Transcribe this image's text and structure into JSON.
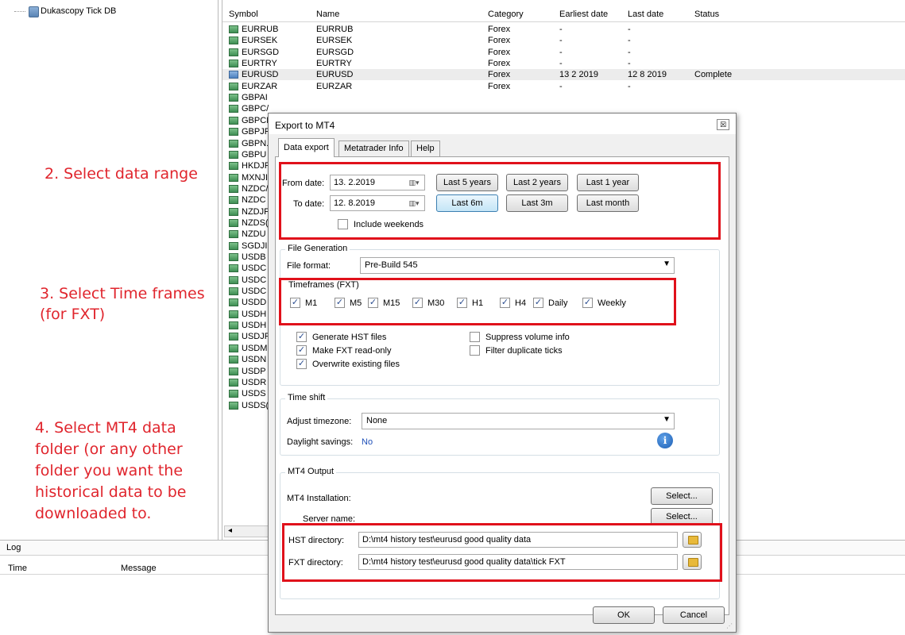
{
  "tree": {
    "root_label": "Dukascopy Tick DB"
  },
  "table": {
    "columns": [
      "Symbol",
      "Name",
      "Category",
      "Earliest date",
      "Last date",
      "Status"
    ],
    "rows": [
      {
        "symbol": "EURRUB",
        "name": "EURRUB",
        "category": "Forex",
        "earliest": "-",
        "last": "-",
        "status": ""
      },
      {
        "symbol": "EURSEK",
        "name": "EURSEK",
        "category": "Forex",
        "earliest": "-",
        "last": "-",
        "status": ""
      },
      {
        "symbol": "EURSGD",
        "name": "EURSGD",
        "category": "Forex",
        "earliest": "-",
        "last": "-",
        "status": ""
      },
      {
        "symbol": "EURTRY",
        "name": "EURTRY",
        "category": "Forex",
        "earliest": "-",
        "last": "-",
        "status": ""
      },
      {
        "symbol": "EURUSD",
        "name": "EURUSD",
        "category": "Forex",
        "earliest": "13 2 2019",
        "last": "12 8 2019",
        "status": "Complete"
      },
      {
        "symbol": "EURZAR",
        "name": "EURZAR",
        "category": "Forex",
        "earliest": "-",
        "last": "-",
        "status": ""
      },
      {
        "symbol": "GBPAI",
        "name": "",
        "category": "",
        "earliest": "",
        "last": "",
        "status": ""
      },
      {
        "symbol": "GBPC/",
        "name": "",
        "category": "",
        "earliest": "",
        "last": "",
        "status": ""
      },
      {
        "symbol": "GBPCI",
        "name": "",
        "category": "",
        "earliest": "",
        "last": "",
        "status": ""
      },
      {
        "symbol": "GBPJF",
        "name": "",
        "category": "",
        "earliest": "",
        "last": "",
        "status": ""
      },
      {
        "symbol": "GBPN.",
        "name": "",
        "category": "",
        "earliest": "",
        "last": "",
        "status": ""
      },
      {
        "symbol": "GBPU",
        "name": "",
        "category": "",
        "earliest": "",
        "last": "",
        "status": ""
      },
      {
        "symbol": "HKDJF",
        "name": "",
        "category": "",
        "earliest": "",
        "last": "",
        "status": ""
      },
      {
        "symbol": "MXNJI",
        "name": "",
        "category": "",
        "earliest": "",
        "last": "",
        "status": ""
      },
      {
        "symbol": "NZDC/",
        "name": "",
        "category": "",
        "earliest": "",
        "last": "",
        "status": ""
      },
      {
        "symbol": "NZDC",
        "name": "",
        "category": "",
        "earliest": "",
        "last": "",
        "status": ""
      },
      {
        "symbol": "NZDJF",
        "name": "",
        "category": "",
        "earliest": "",
        "last": "",
        "status": ""
      },
      {
        "symbol": "NZDS(",
        "name": "",
        "category": "",
        "earliest": "",
        "last": "",
        "status": ""
      },
      {
        "symbol": "NZDU",
        "name": "",
        "category": "",
        "earliest": "",
        "last": "",
        "status": ""
      },
      {
        "symbol": "SGDJI",
        "name": "",
        "category": "",
        "earliest": "",
        "last": "",
        "status": ""
      },
      {
        "symbol": "USDB",
        "name": "",
        "category": "",
        "earliest": "",
        "last": "",
        "status": ""
      },
      {
        "symbol": "USDC",
        "name": "",
        "category": "",
        "earliest": "",
        "last": "",
        "status": ""
      },
      {
        "symbol": "USDC",
        "name": "",
        "category": "",
        "earliest": "",
        "last": "",
        "status": ""
      },
      {
        "symbol": "USDC",
        "name": "",
        "category": "",
        "earliest": "",
        "last": "",
        "status": ""
      },
      {
        "symbol": "USDD",
        "name": "",
        "category": "",
        "earliest": "",
        "last": "",
        "status": ""
      },
      {
        "symbol": "USDH",
        "name": "",
        "category": "",
        "earliest": "",
        "last": "",
        "status": ""
      },
      {
        "symbol": "USDH",
        "name": "",
        "category": "",
        "earliest": "",
        "last": "",
        "status": ""
      },
      {
        "symbol": "USDJF",
        "name": "",
        "category": "",
        "earliest": "",
        "last": "",
        "status": ""
      },
      {
        "symbol": "USDM",
        "name": "",
        "category": "",
        "earliest": "",
        "last": "",
        "status": ""
      },
      {
        "symbol": "USDN",
        "name": "",
        "category": "",
        "earliest": "",
        "last": "",
        "status": ""
      },
      {
        "symbol": "USDP",
        "name": "",
        "category": "",
        "earliest": "",
        "last": "",
        "status": ""
      },
      {
        "symbol": "USDR",
        "name": "",
        "category": "",
        "earliest": "",
        "last": "",
        "status": ""
      },
      {
        "symbol": "USDS",
        "name": "",
        "category": "",
        "earliest": "",
        "last": "",
        "status": ""
      },
      {
        "symbol": "USDS(",
        "name": "",
        "category": "",
        "earliest": "",
        "last": "",
        "status": ""
      }
    ],
    "selected_index": 4,
    "scroll_left_glyph": "◂"
  },
  "log": {
    "title": "Log",
    "columns": [
      "Time",
      "Message"
    ]
  },
  "annotations": {
    "step2": "2. Select data range",
    "step3_line1": "3. Select Time frames",
    "step3_line2": "(for FXT)",
    "step4_line1": "4. Select MT4 data",
    "step4_line2": "folder (or any other",
    "step4_line3": "folder you want the",
    "step4_line4": "historical data to be",
    "step4_line5": "downloaded to."
  },
  "dialog": {
    "title": "Export to MT4",
    "close_glyph": "☒",
    "tabs": [
      "Data export",
      "Metatrader Info",
      "Help"
    ],
    "active_tab": 0,
    "from_label": "From date:",
    "from_value": "13. 2.2019",
    "to_label": "To date:",
    "to_value": "12. 8.2019",
    "cal_glyph": "▥▾",
    "range_buttons_row1": [
      "Last 5 years",
      "Last 2 years",
      "Last 1 year"
    ],
    "range_buttons_row2": [
      "Last 6m",
      "Last 3m",
      "Last month"
    ],
    "include_weekends_label": "Include weekends",
    "include_weekends": false,
    "file_generation": {
      "title": "File Generation",
      "format_label": "File format:",
      "format_value": "Pre-Build 545",
      "timeframes_title": "Timeframes (FXT)",
      "timeframes": [
        {
          "label": "M1",
          "checked": true
        },
        {
          "label": "M5",
          "checked": true
        },
        {
          "label": "M15",
          "checked": true
        },
        {
          "label": "M30",
          "checked": true
        },
        {
          "label": "H1",
          "checked": true
        },
        {
          "label": "H4",
          "checked": true
        },
        {
          "label": "Daily",
          "checked": true
        },
        {
          "label": "Weekly",
          "checked": true
        }
      ],
      "options_left": [
        {
          "label": "Generate HST files",
          "checked": true
        },
        {
          "label": "Make FXT read-only",
          "checked": true
        },
        {
          "label": "Overwrite existing files",
          "checked": true
        }
      ],
      "options_right": [
        {
          "label": "Suppress volume info",
          "checked": false
        },
        {
          "label": "Filter duplicate ticks",
          "checked": false
        }
      ]
    },
    "time_shift": {
      "title": "Time shift",
      "tz_label": "Adjust timezone:",
      "tz_value": "None",
      "dst_label": "Daylight savings:",
      "dst_value": "No",
      "info_glyph": "i"
    },
    "mt4_output": {
      "title": "MT4 Output",
      "install_label": "MT4 Installation:",
      "server_label": "Server name:",
      "select_label": "Select...",
      "hst_label": "HST directory:",
      "hst_value": "D:\\mt4 history test\\eurusd good quality data",
      "fxt_label": "FXT directory:",
      "fxt_value": "D:\\mt4 history test\\eurusd good quality data\\tick FXT"
    },
    "ok_label": "OK",
    "cancel_label": "Cancel",
    "combo_arrow": "▼",
    "grip_glyph": "⋰"
  },
  "colors": {
    "annotation_red": "#e0252d",
    "highlight_box": "#e0111b",
    "link_blue": "#1e4fb8"
  }
}
